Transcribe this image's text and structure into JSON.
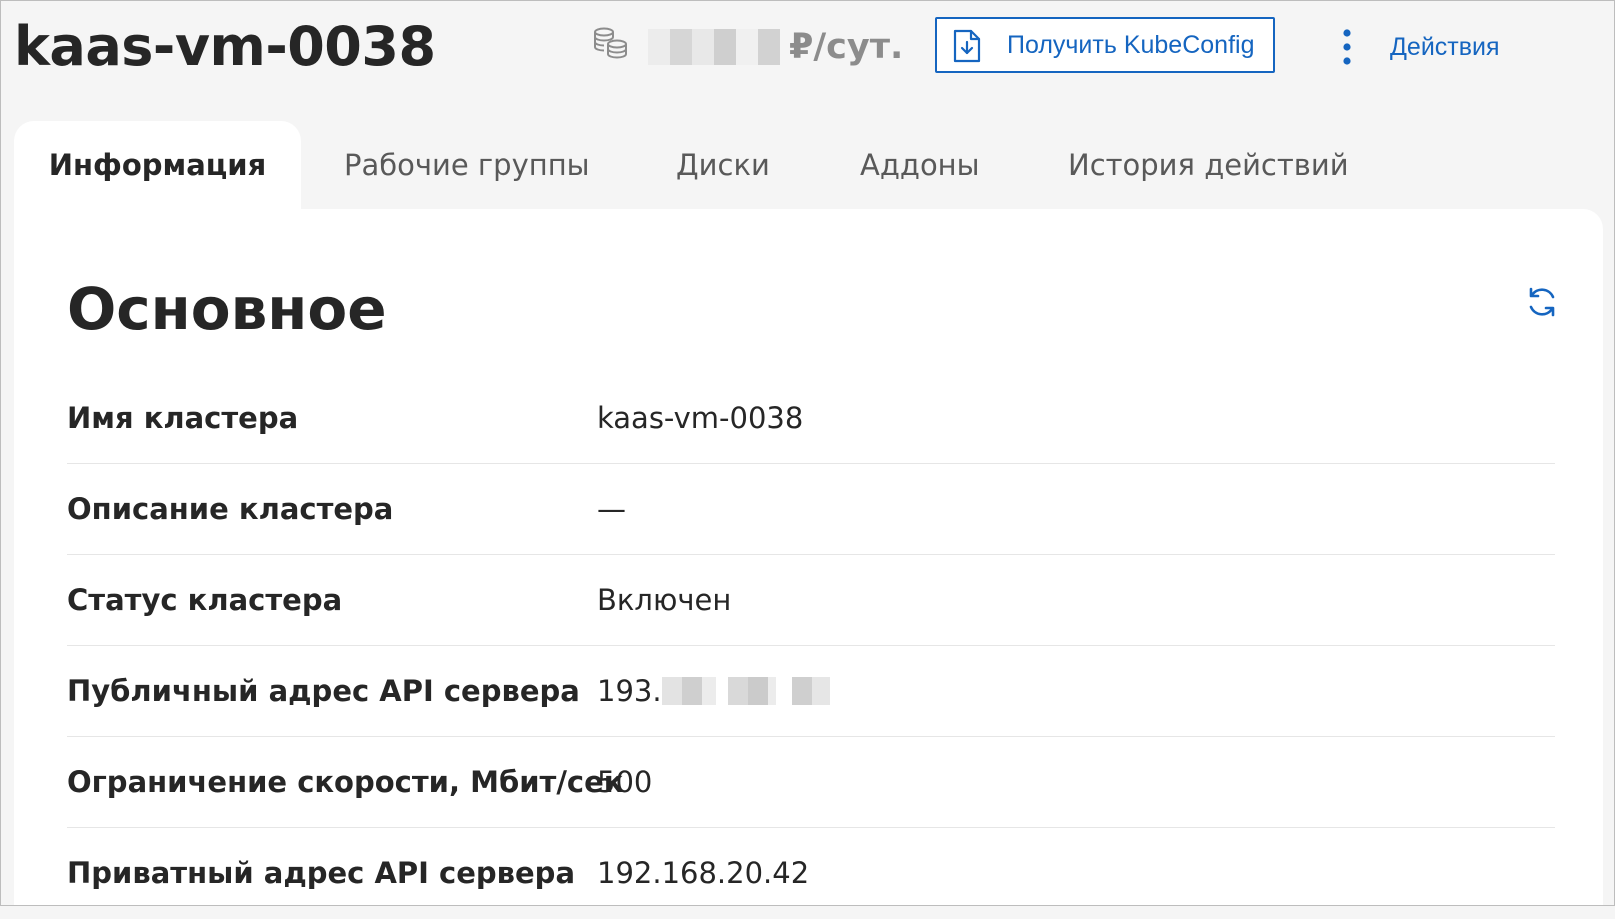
{
  "header": {
    "title": "kaas-vm-0038",
    "price_unit": "₽/сут.",
    "kubeconfig_label": "Получить KubeConfig",
    "actions_label": "Действия",
    "accent_color": "#1565c0"
  },
  "tabs": [
    {
      "label": "Информация",
      "active": true
    },
    {
      "label": "Рабочие группы",
      "active": false
    },
    {
      "label": "Диски",
      "active": false
    },
    {
      "label": "Аддоны",
      "active": false
    },
    {
      "label": "История действий",
      "active": false
    }
  ],
  "main": {
    "section_title": "Основное",
    "rows": [
      {
        "label": "Имя кластера",
        "value": "kaas-vm-0038"
      },
      {
        "label": "Описание кластера",
        "value": "—"
      },
      {
        "label": "Статус кластера",
        "value": "Включен"
      },
      {
        "label": "Публичный адрес API сервера",
        "value": "193."
      },
      {
        "label": "Ограничение скорости, Мбит/сек",
        "value": "500"
      },
      {
        "label": "Приватный адрес API сервера",
        "value": "192.168.20.42"
      }
    ]
  },
  "icons": {
    "price": "coins-icon",
    "kubeconfig": "file-download-icon",
    "actions": "vertical-dots-icon",
    "refresh": "refresh-icon"
  }
}
